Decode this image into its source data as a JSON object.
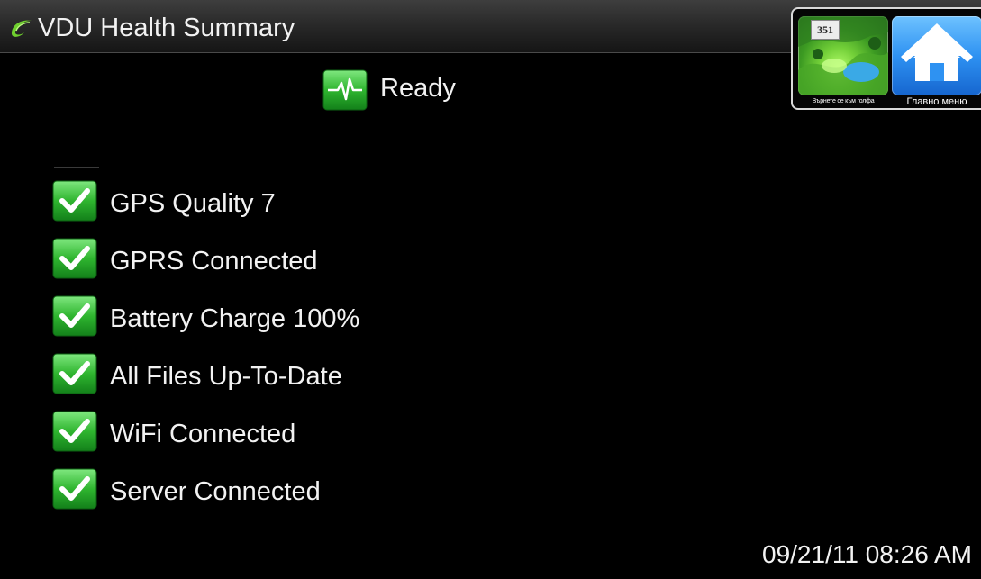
{
  "header": {
    "title": "VDU Health Summary",
    "logo_icon": "swoosh-logo-icon"
  },
  "nav": {
    "golf": {
      "label": "Върнете се към голфа",
      "hole_badge": "351",
      "icon": "golf-course-thumbnail-icon"
    },
    "home": {
      "label": "Главно меню",
      "icon": "home-icon"
    }
  },
  "status": {
    "label": "Ready",
    "icon": "heartbeat-icon"
  },
  "checks": [
    {
      "label": "GPS Quality 7",
      "ok": true
    },
    {
      "label": "GPRS Connected",
      "ok": true
    },
    {
      "label": "Battery Charge 100%",
      "ok": true
    },
    {
      "label": "All Files Up-To-Date",
      "ok": true
    },
    {
      "label": "WiFi Connected",
      "ok": true
    },
    {
      "label": "Server Connected",
      "ok": true
    }
  ],
  "timestamp": "09/21/11 08:26 AM",
  "colors": {
    "background": "#000000",
    "check_green": "#2fb52f",
    "home_blue": "#2e92f2",
    "text": "#f2f2f2"
  }
}
